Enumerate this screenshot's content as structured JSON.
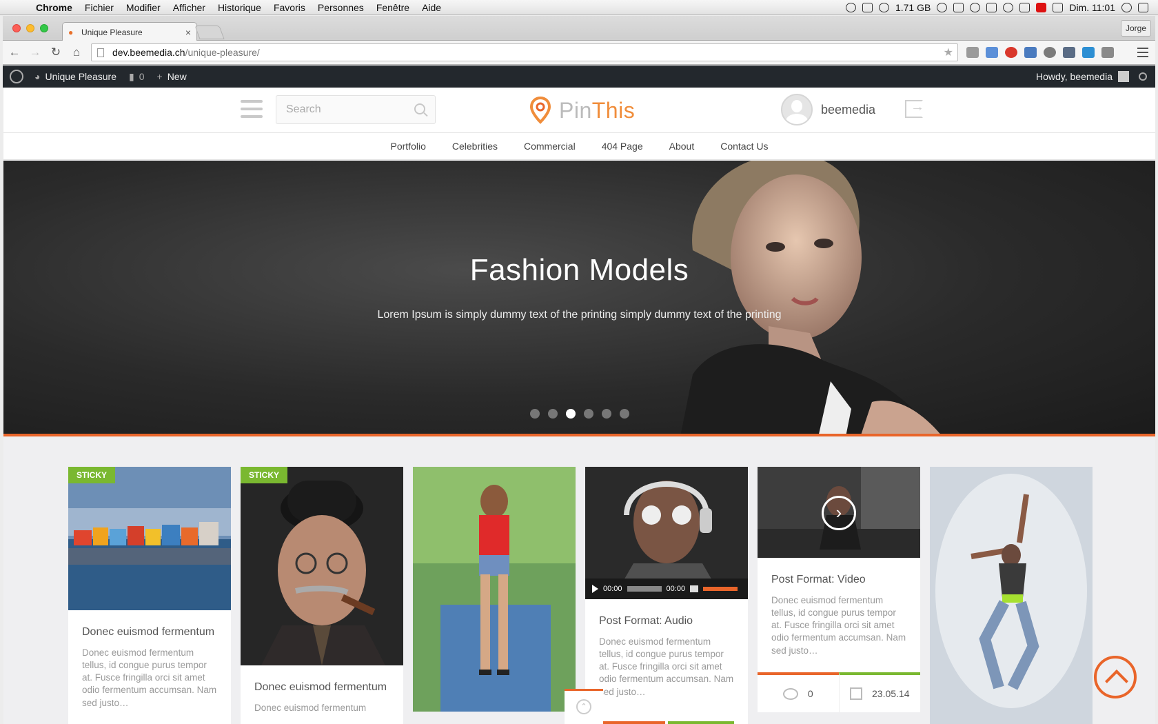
{
  "os_menubar": {
    "app": "Chrome",
    "menus": [
      "Fichier",
      "Modifier",
      "Afficher",
      "Historique",
      "Favoris",
      "Personnes",
      "Fenêtre",
      "Aide"
    ],
    "memory": "1.71 GB",
    "clock": "Dim. 11:01"
  },
  "browser": {
    "tab_title": "Unique Pleasure",
    "profile": "Jorge",
    "url_host": "dev.beemedia.ch",
    "url_path": "/unique-pleasure/"
  },
  "wp_adminbar": {
    "site_name": "Unique Pleasure",
    "comments_count": "0",
    "new_label": "New",
    "howdy": "Howdy, beemedia"
  },
  "header": {
    "search_placeholder": "Search",
    "logo_pin": "Pin",
    "logo_this": "This",
    "username": "beemedia"
  },
  "nav": [
    "Portfolio",
    "Celebrities",
    "Commercial",
    "404 Page",
    "About",
    "Contact Us"
  ],
  "hero": {
    "title": "Fashion Models",
    "subtitle": "Lorem Ipsum is simply dummy text of the printing simply dummy text of the printing",
    "slides": 6,
    "active_slide": 3
  },
  "cards": [
    {
      "sticky": "STICKY",
      "title": "Donec euismod fermentum",
      "excerpt": "Donec euismod fermentum tellus, id congue purus tempor at. Fusce fringilla orci sit amet odio fermentum accumsan. Nam sed justo…"
    },
    {
      "sticky": "STICKY",
      "title": "Donec euismod fermentum",
      "excerpt": "Donec euismod fermentum"
    },
    {},
    {
      "title": "Post Format: Audio",
      "excerpt": "Donec euismod fermentum tellus, id congue purus tempor at. Fusce fringilla orci sit amet odio fermentum accumsan. Nam sed justo…",
      "time_current": "00:00",
      "time_total": "00:00"
    },
    {
      "title": "Post Format: Video",
      "excerpt": "Donec euismod fermentum tellus, id congue purus tempor at. Fusce fringilla orci sit amet odio fermentum accumsan. Nam sed justo…",
      "comments": "0",
      "date": "23.05.14"
    },
    {}
  ]
}
